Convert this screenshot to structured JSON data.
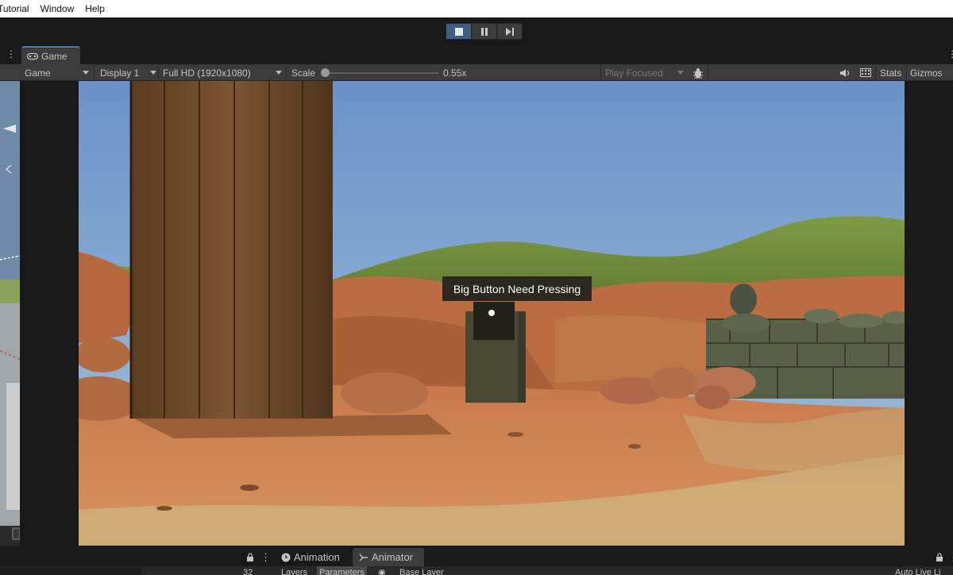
{
  "menu": {
    "items": [
      "Tutorial",
      "Window",
      "Help"
    ]
  },
  "playbar": {
    "buttons": [
      "stop-icon",
      "pause-icon",
      "step-icon"
    ]
  },
  "tabs": {
    "game_label": "Game",
    "panel_menu": "⋮"
  },
  "toolbar": {
    "view_mode": "Game",
    "display": "Display 1",
    "resolution": "Full HD (1920x1080)",
    "scale_label": "Scale",
    "scale_value": "0.55x",
    "scale_fraction": 0.0,
    "play_mode": "Play Focused",
    "stats_label": "Stats",
    "gizmos_label": "Gizmos"
  },
  "scene": {
    "tooltip": "Big Button Need Pressing",
    "colors": {
      "sky_top": "#6b91c9",
      "sky_bottom": "#a9c3d6",
      "sand": "#d0865a",
      "rock": "#b86f44",
      "wood": "#6b4a2b",
      "grass": "#6f8a3a"
    }
  },
  "bottom": {
    "tab_animation": "Animation",
    "tab_animator": "Animator",
    "layers_label": "Layers",
    "parameters_label": "Parameters",
    "base_layer": "Base Layer",
    "count": "32",
    "auto_live": "Auto Live Li"
  }
}
